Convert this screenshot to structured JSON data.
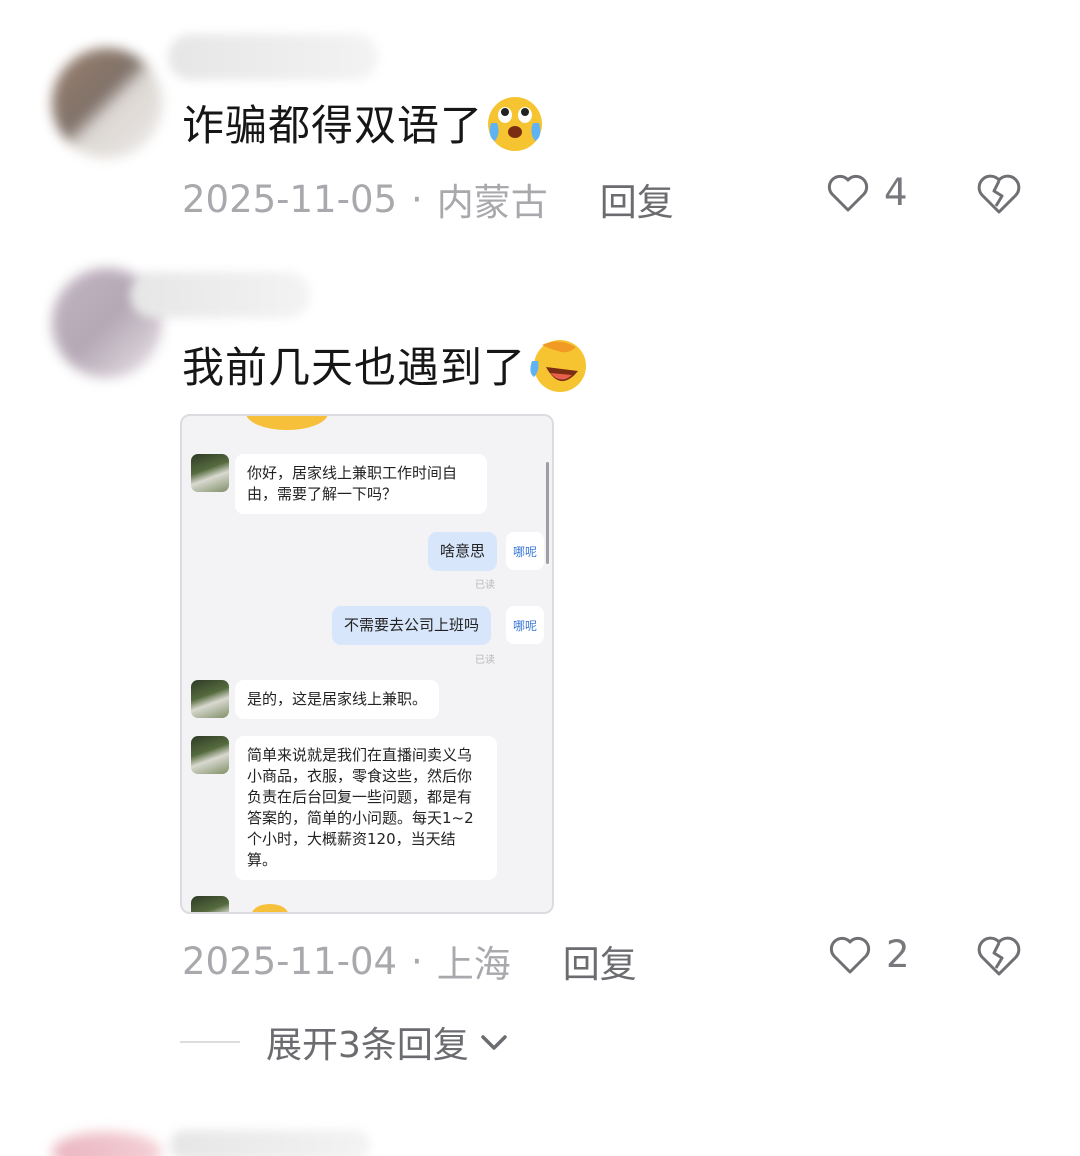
{
  "comments": [
    {
      "text": "诈骗都得双语了",
      "emoji": "crying-laugh-emoji",
      "date": "2025-11-05",
      "location": "内蒙古",
      "separator": "·",
      "reply_label": "回复",
      "likes": "4"
    },
    {
      "text": "我前几天也遇到了",
      "emoji": "laughing-tears-emoji",
      "date": "2025-11-04",
      "location": "上海",
      "separator": "·",
      "reply_label": "回复",
      "likes": "2",
      "attached_chat": {
        "messages": [
          {
            "from": "other",
            "text": "你好，居家线上兼职工作时间自由，需要了解一下吗？"
          },
          {
            "from": "me",
            "text": "啥意思",
            "tag": "哪呢",
            "status": "已读"
          },
          {
            "from": "me",
            "text": "不需要去公司上班吗",
            "tag": "哪呢",
            "status": "已读"
          },
          {
            "from": "other",
            "text": "是的，这是居家线上兼职。"
          },
          {
            "from": "other",
            "text": "简单来说就是我们在直播间卖义乌小商品，衣服，零食这些，然后你负责在后台回复一些问题，都是有答案的，简单的小问题。每天1~2个小时，大概薪资120，当天结算。"
          }
        ]
      }
    }
  ],
  "expand_replies": "展开3条回复",
  "colors": {
    "meta_gray": "#a9a9ad",
    "reply_gray": "#6b6b70",
    "my_bubble": "#d8e6fb",
    "tag_blue": "#3a78d8"
  }
}
